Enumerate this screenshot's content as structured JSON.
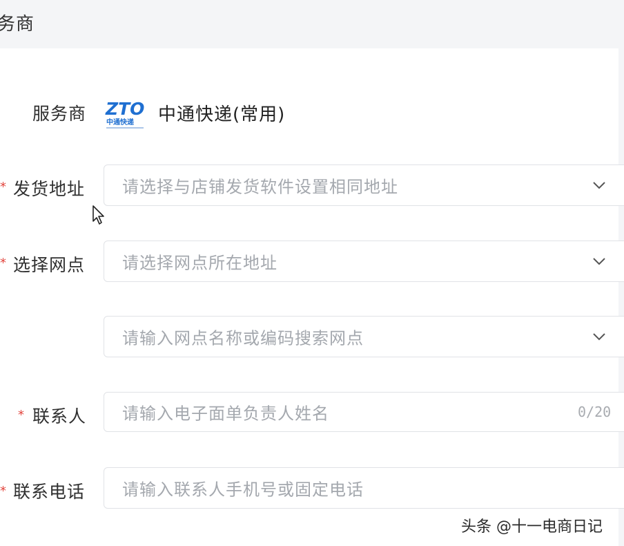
{
  "header": {
    "title": "务商"
  },
  "provider": {
    "label": "服务商",
    "logo_text": "ZTO",
    "logo_subtext": "中通快递",
    "name": "中通快递(常用)"
  },
  "form": {
    "ship_address": {
      "label": "发货地址",
      "placeholder": "请选择与店铺发货软件设置相同地址",
      "required": true
    },
    "outlet": {
      "label": "选择网点",
      "placeholder": "请选择网点所在地址",
      "required": true
    },
    "outlet_search": {
      "placeholder": "请输入网点名称或编码搜索网点"
    },
    "contact": {
      "label": "联系人",
      "placeholder": "请输入电子面单负责人姓名",
      "counter": "0/20",
      "required": true
    },
    "phone": {
      "label": "联系电话",
      "placeholder": "请输入联系人手机号或固定电话",
      "required": true
    }
  },
  "required_mark": "*",
  "watermark": "头条 @十一电商日记",
  "colors": {
    "accent": "#1f6fd1",
    "required": "#e2463e",
    "placeholder": "#a4a8ae"
  }
}
